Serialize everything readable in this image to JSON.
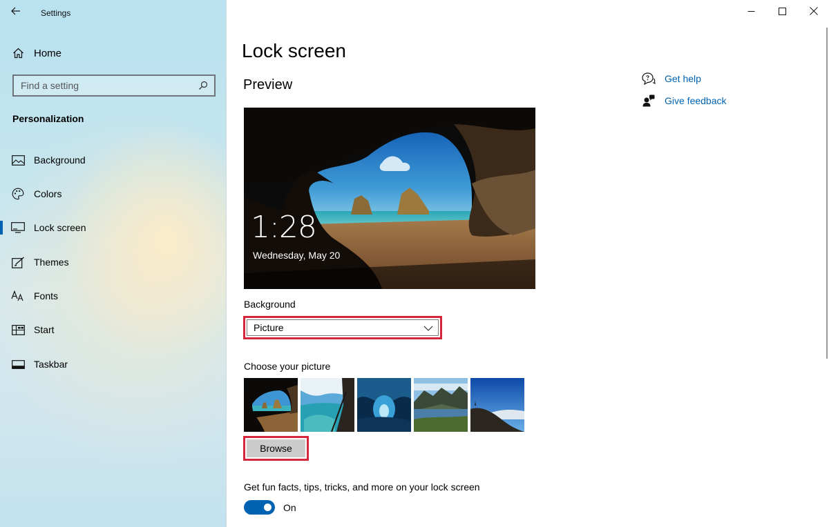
{
  "window": {
    "title": "Settings",
    "controls": [
      "minimize",
      "maximize",
      "close"
    ]
  },
  "sidebar": {
    "home_label": "Home",
    "search_placeholder": "Find a setting",
    "section_label": "Personalization",
    "items": [
      {
        "label": "Background",
        "icon": "picture-icon",
        "selected": false
      },
      {
        "label": "Colors",
        "icon": "palette-icon",
        "selected": false
      },
      {
        "label": "Lock screen",
        "icon": "monitor-lock-icon",
        "selected": true
      },
      {
        "label": "Themes",
        "icon": "brush-icon",
        "selected": false
      },
      {
        "label": "Fonts",
        "icon": "font-icon",
        "selected": false
      },
      {
        "label": "Start",
        "icon": "start-grid-icon",
        "selected": false
      },
      {
        "label": "Taskbar",
        "icon": "taskbar-icon",
        "selected": false
      }
    ]
  },
  "main": {
    "title": "Lock screen",
    "preview_heading": "Preview",
    "preview": {
      "time": "1:28",
      "date": "Wednesday, May 20"
    },
    "background_label": "Background",
    "background_value": "Picture",
    "choose_label": "Choose your picture",
    "thumbnails": [
      "cave-beach",
      "cliff-ocean",
      "ice-cave",
      "mountain-lake",
      "coastal-hill"
    ],
    "browse_label": "Browse",
    "tips_label": "Get fun facts, tips, tricks, and more on your lock screen",
    "tips_toggle": {
      "state_label": "On",
      "on": true
    }
  },
  "help": {
    "get_help": "Get help",
    "give_feedback": "Give feedback"
  },
  "colors": {
    "accent": "#0063b1",
    "highlight_border": "#d6263b"
  }
}
